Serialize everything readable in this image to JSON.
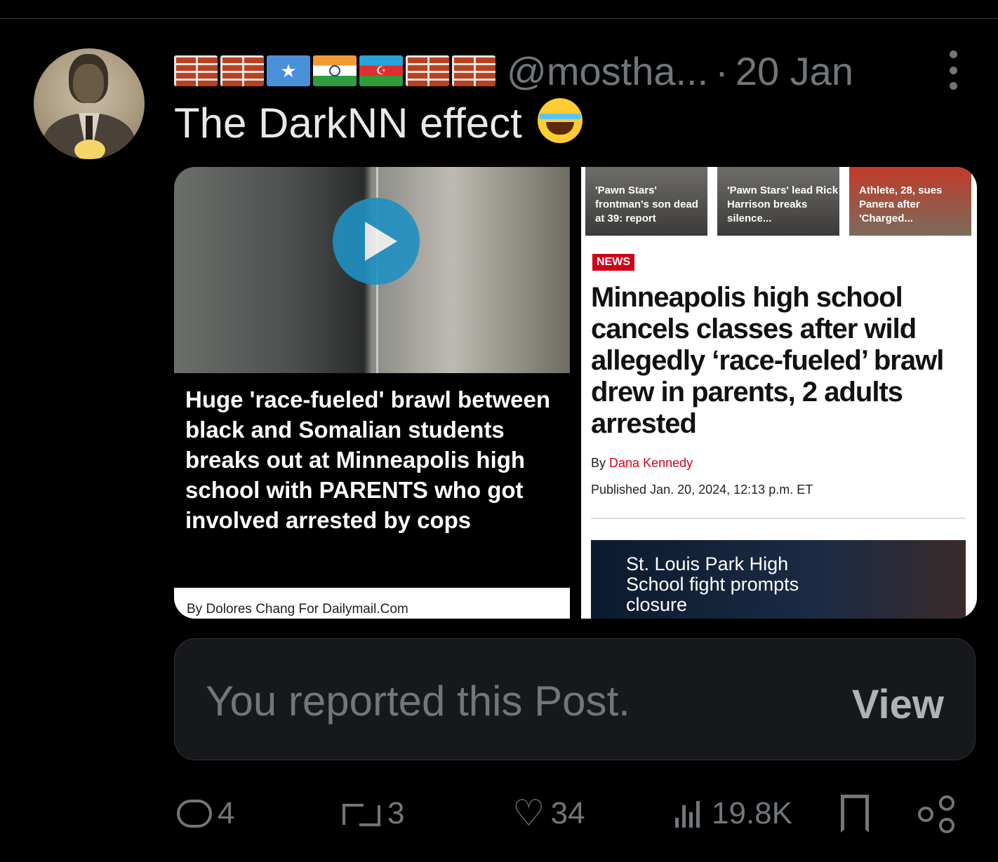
{
  "post": {
    "display_name_flags": [
      "brick-icon",
      "brick-icon",
      "somalia-flag-icon",
      "india-flag-icon",
      "azerbaijan-flag-icon",
      "brick-icon",
      "brick-icon"
    ],
    "handle": "@mostha...",
    "separator": "·",
    "date": "20 Jan",
    "text": "The DarkNN effect",
    "emoji": "face-with-tears-of-joy-icon"
  },
  "left_card": {
    "headline": "Huge 'race-fueled' brawl between black and Somalian students breaks out at Minneapolis high school with PARENTS who got involved arrested by cops",
    "byline": "By Dolores Chang For Dailymail.Com"
  },
  "right_card": {
    "thumbnails": [
      "'Pawn Stars' frontman's son dead at 39: report",
      "'Pawn Stars' lead Rick Harrison breaks silence...",
      "Athlete, 28, sues Panera after 'Charged..."
    ],
    "badge": "NEWS",
    "headline": "Minneapolis high school cancels classes after wild allegedly ‘race-fueled’ brawl drew in parents, 2 adults arrested",
    "by_prefix": "By",
    "author": "Dana Kennedy",
    "published": "Published Jan. 20, 2024, 12:13 p.m. ET",
    "video_caption": "St. Louis Park High School fight prompts closure"
  },
  "report_notice": {
    "text": "You reported this Post.",
    "view_label": "View"
  },
  "actions": {
    "replies": "4",
    "reposts": "3",
    "likes": "34",
    "views": "19.8K"
  },
  "colors": {
    "background": "#000000",
    "muted": "#71767b",
    "text": "#e7e9ea",
    "news_red": "#d0021b"
  }
}
